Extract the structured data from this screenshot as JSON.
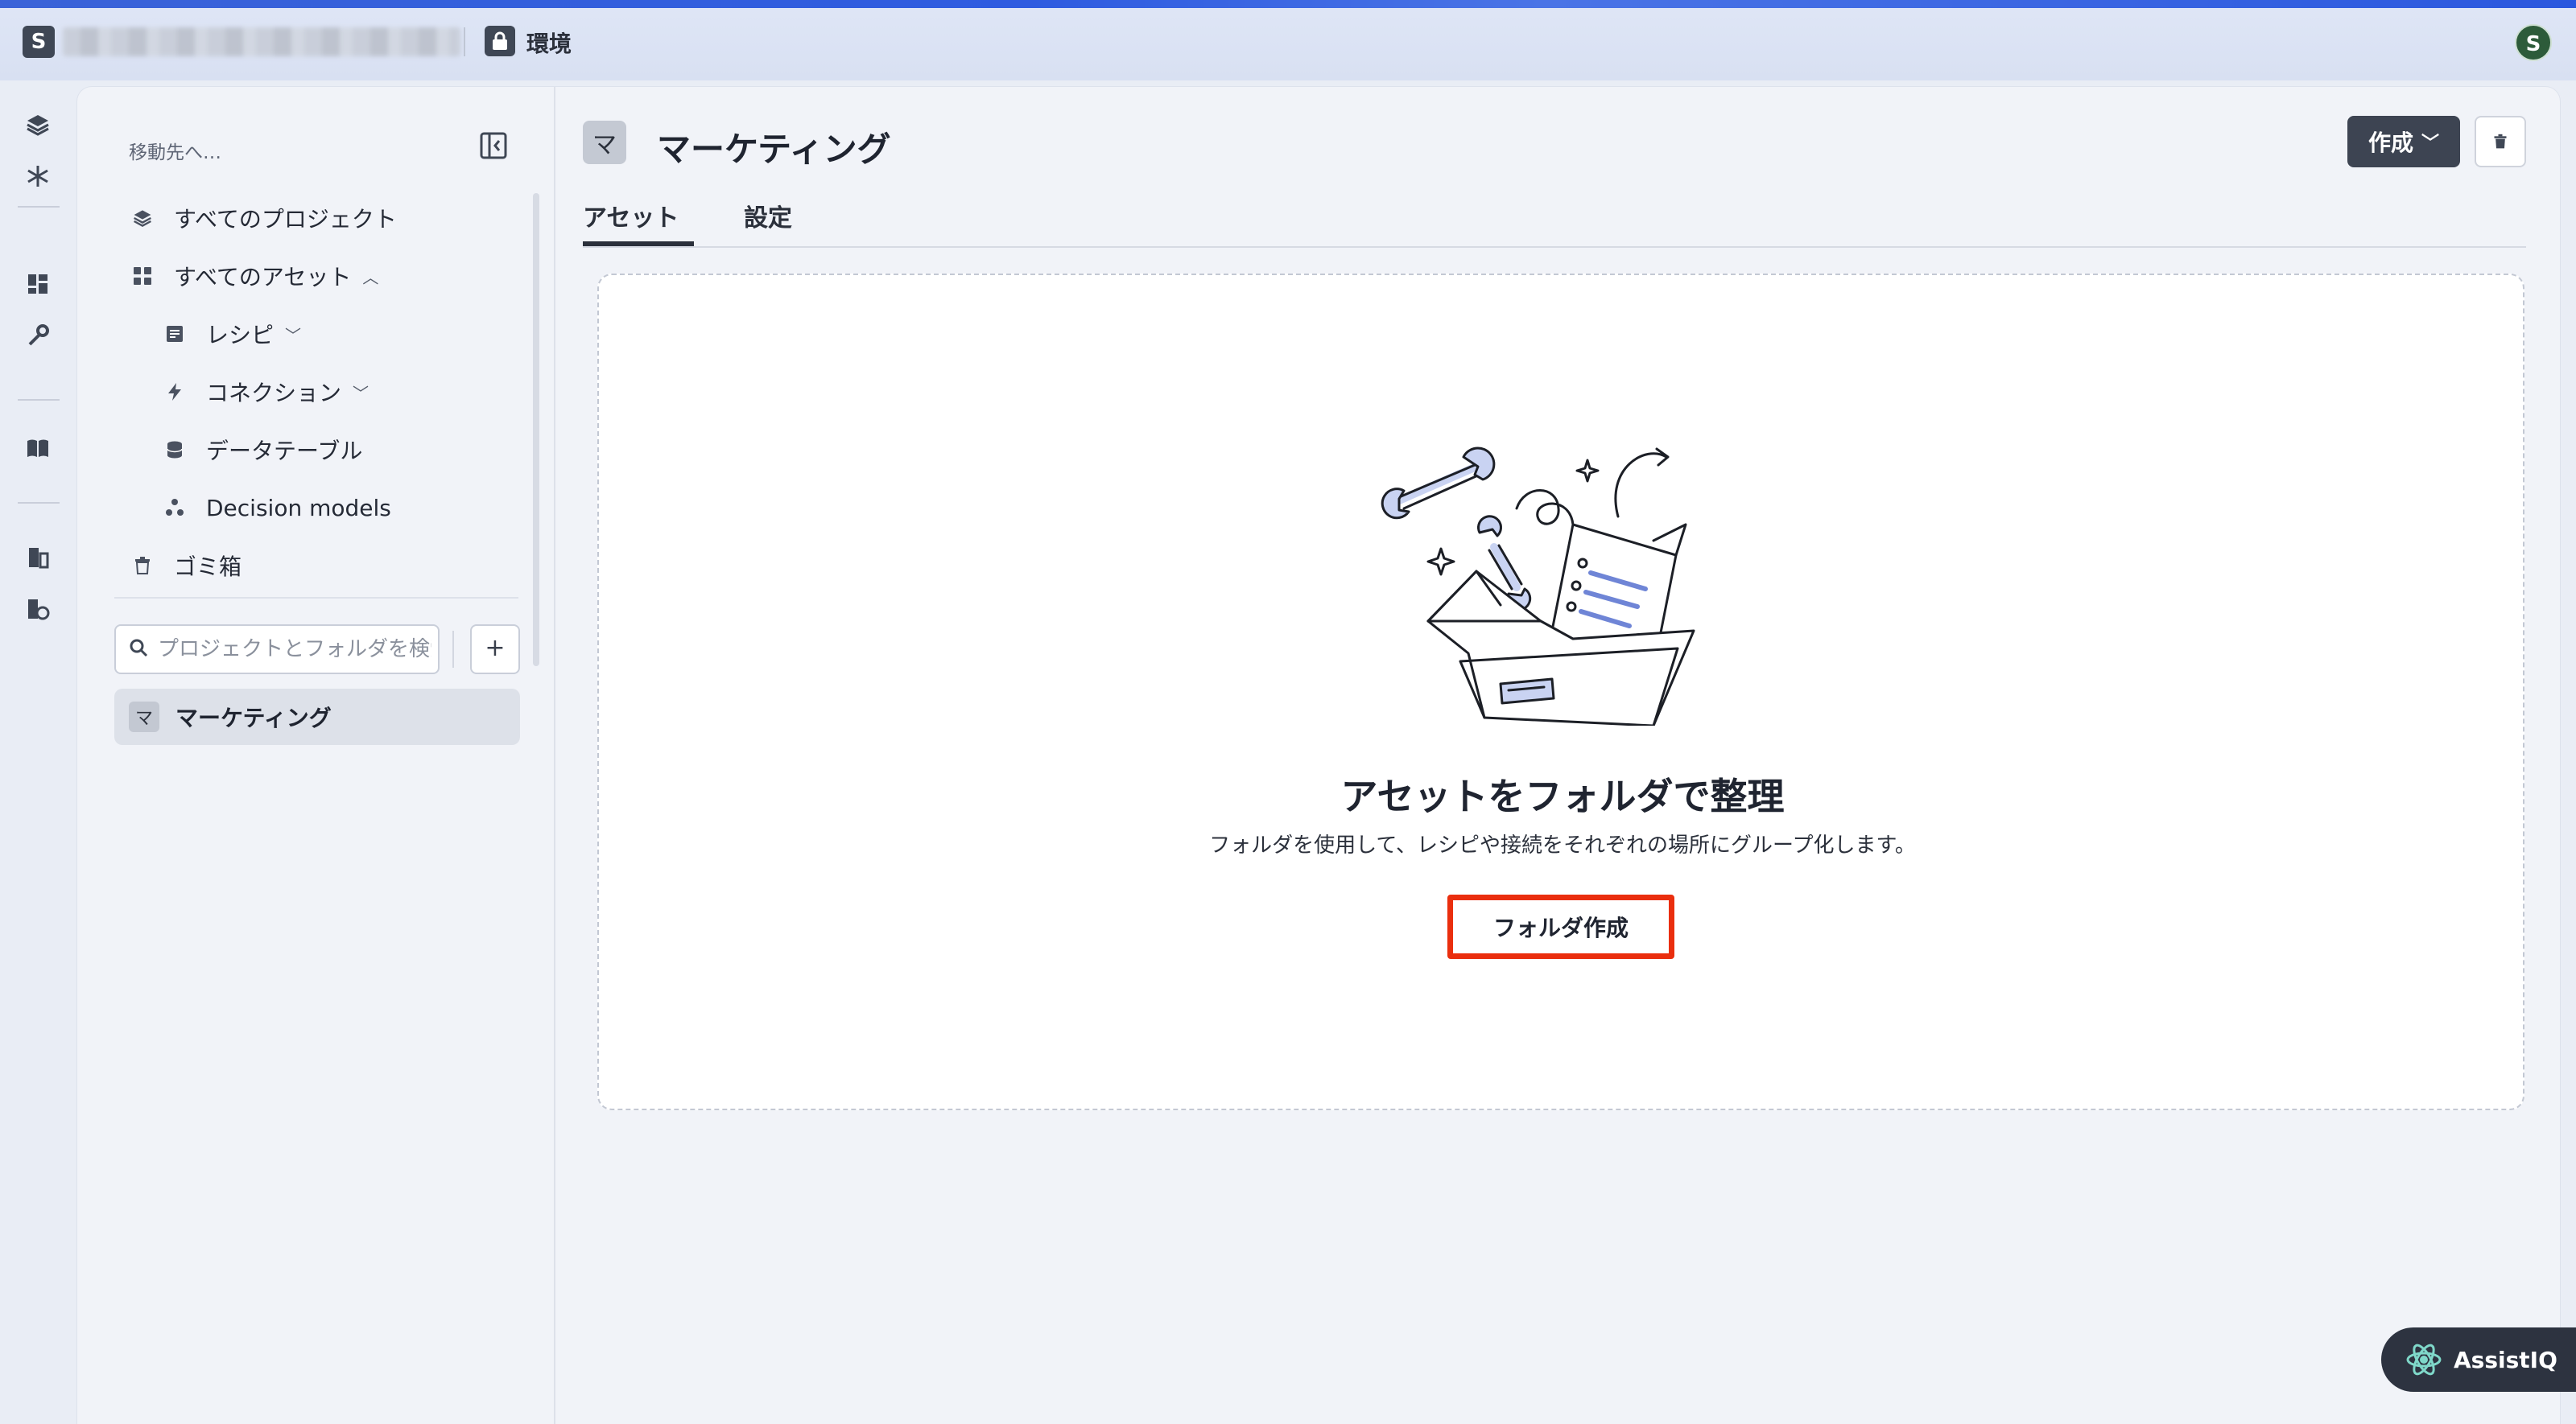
{
  "topbar": {
    "org_badge": "S",
    "environment_label": "環境",
    "user_initial": "S"
  },
  "rail": {
    "icons": [
      "layers-icon",
      "snowflake-icon",
      "dashboard-icon",
      "wrench-icon",
      "book-icon",
      "building-icon",
      "billing-icon"
    ],
    "brand": "workato-logo-icon"
  },
  "sidebar": {
    "goto_label": "移動先へ…",
    "items": [
      {
        "label": "すべてのプロジェクト",
        "icon": "layers-icon"
      },
      {
        "label": "すべてのアセット",
        "icon": "grid-icon",
        "expanded": true
      },
      {
        "label": "レシピ",
        "icon": "recipe-icon"
      },
      {
        "label": "コネクション",
        "icon": "bolt-icon"
      },
      {
        "label": "データテーブル",
        "icon": "database-icon"
      },
      {
        "label": "Decision models",
        "icon": "decision-icon"
      },
      {
        "label": "ゴミ箱",
        "icon": "trash-icon"
      }
    ],
    "search_placeholder": "プロジェクトとフォルダを検索",
    "add_label": "+",
    "project": {
      "badge": "マ",
      "name": "マーケティング"
    }
  },
  "content": {
    "title_badge": "マ",
    "title": "マーケティング",
    "create_label": "作成",
    "tabs": [
      {
        "label": "アセット",
        "active": true
      },
      {
        "label": "設定",
        "active": false
      }
    ],
    "empty": {
      "title": "アセットをフォルダで整理",
      "description": "フォルダを使用して、レシピや接続をそれぞれの場所にグループ化します。",
      "button_label": "フォルダ作成"
    }
  },
  "assist": {
    "label": "AssistIQ"
  },
  "colors": {
    "highlight": "#ea2e0e",
    "dark_button": "#3d4452",
    "accent": "#2e5be0"
  }
}
